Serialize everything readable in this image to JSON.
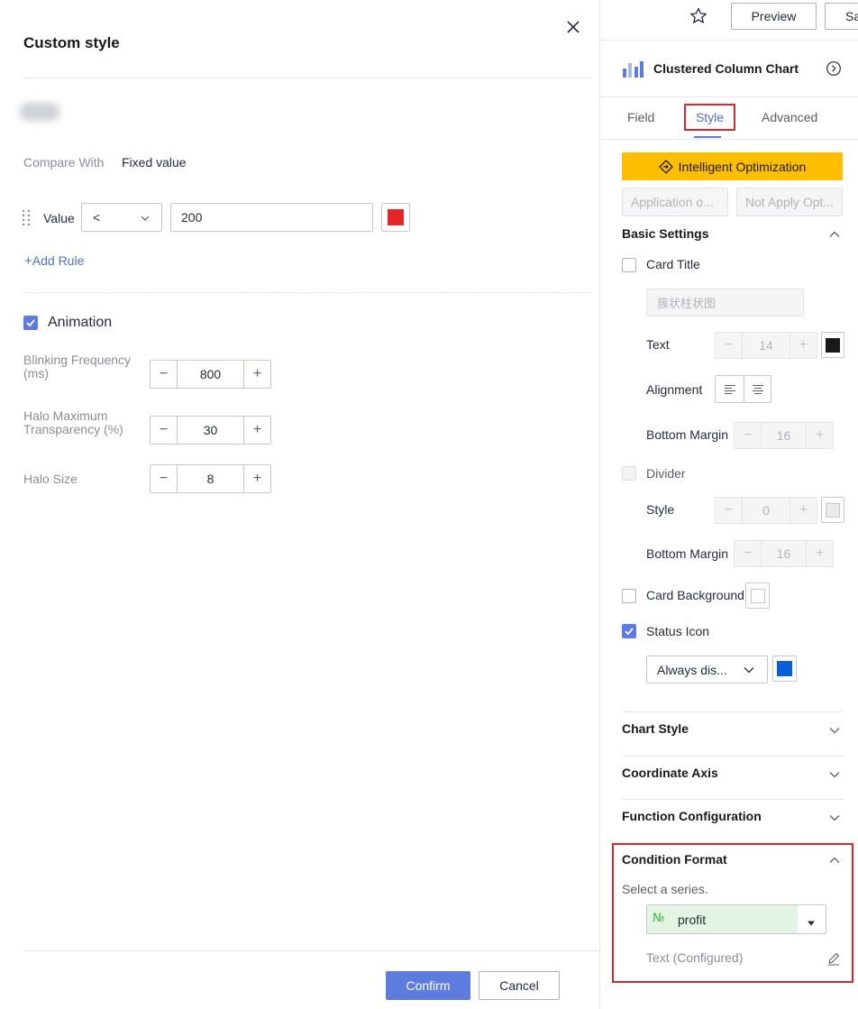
{
  "dialog": {
    "title": "Custom style",
    "compare_with_label": "Compare With",
    "compare_with_value": "Fixed value",
    "rule": {
      "label": "Value",
      "operator": "<",
      "value": "200",
      "color": "#e5252a"
    },
    "add_rule_label": "Add Rule",
    "animation": {
      "label": "Animation",
      "checked": true,
      "blinking_label": "Blinking Frequency (ms)",
      "blinking_value": "800",
      "halo_transparency_label": "Halo Maximum Transparency (%)",
      "halo_transparency_value": "30",
      "halo_size_label": "Halo Size",
      "halo_size_value": "8"
    },
    "confirm_label": "Confirm",
    "cancel_label": "Cancel"
  },
  "topbar": {
    "preview_label": "Preview",
    "save_label": "Sa"
  },
  "panel": {
    "chart_title": "Clustered Column Chart",
    "tabs": [
      {
        "label": "Field"
      },
      {
        "label": "Style"
      },
      {
        "label": "Advanced"
      }
    ],
    "intelligent_optimization_label": "Intelligent Optimization",
    "application_label": "Application o...",
    "not_apply_label": "Not Apply Opt...",
    "basic_settings": {
      "title": "Basic Settings",
      "card_title_label": "Card Title",
      "card_title_placeholder": "簇状柱状图",
      "text_label": "Text",
      "text_size": "14",
      "text_color": "#1a1a1a",
      "alignment_label": "Alignment",
      "bottom_margin_label": "Bottom Margin",
      "bottom_margin_value": "16",
      "divider_label": "Divider",
      "style_label": "Style",
      "style_value": "0",
      "divider_bottom_margin_label": "Bottom Margin",
      "divider_bottom_margin_value": "16",
      "card_background_label": "Card Background",
      "status_icon_label": "Status Icon",
      "status_icon_checked": true,
      "status_display_value": "Always dis...",
      "status_color": "#0a5fd6"
    },
    "sections": {
      "chart_style": "Chart Style",
      "coordinate_axis": "Coordinate Axis",
      "function_configuration": "Function Configuration"
    },
    "condition_format": {
      "title": "Condition Format",
      "select_series_label": "Select a series.",
      "series_type_icon": "№",
      "series_value": "profit",
      "text_configured_label": "Text (Configured)"
    }
  },
  "colors": {
    "accent": "#5e7ce0",
    "link": "#526ecc",
    "highlight_box": "#d9252e",
    "optimization": "#ffbf00",
    "series_bg": "#e3f4e3"
  }
}
